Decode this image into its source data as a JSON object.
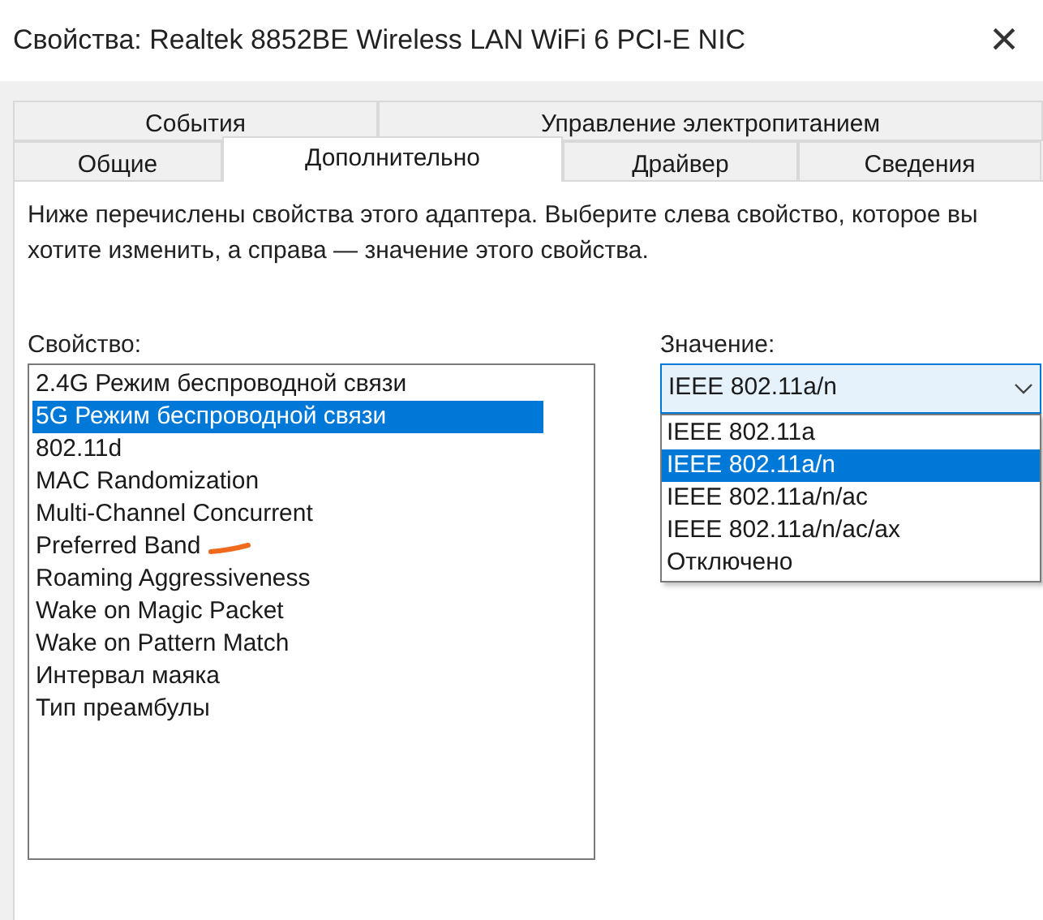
{
  "window": {
    "title": "Свойства: Realtek 8852BE Wireless LAN WiFi 6 PCI-E NIC",
    "close": "×"
  },
  "tab_rows": [
    [
      {
        "label": "События",
        "selected": false
      },
      {
        "label": "Управление электропитанием",
        "selected": false
      }
    ],
    [
      {
        "label": "Общие",
        "selected": false
      },
      {
        "label": "Дополнительно",
        "selected": true
      },
      {
        "label": "Драйвер",
        "selected": false
      },
      {
        "label": "Сведения",
        "selected": false
      }
    ]
  ],
  "description": "Ниже перечислены свойства этого адаптера. Выберите слева свойство, которое вы хотите изменить, а справа — значение этого свойства.",
  "property_label": "Свойство:",
  "properties": [
    {
      "label": "2.4G Режим беспроводной связи",
      "selected": false
    },
    {
      "label": "5G Режим беспроводной связи",
      "selected": true
    },
    {
      "label": "802.11d",
      "selected": false
    },
    {
      "label": "MAC Randomization",
      "selected": false
    },
    {
      "label": "Multi-Channel Concurrent",
      "selected": false
    },
    {
      "label": "Preferred Band",
      "selected": false
    },
    {
      "label": "Roaming Aggressiveness",
      "selected": false
    },
    {
      "label": "Wake on Magic Packet",
      "selected": false
    },
    {
      "label": "Wake on Pattern Match",
      "selected": false
    },
    {
      "label": "Интервал маяка",
      "selected": false
    },
    {
      "label": "Тип преамбулы",
      "selected": false
    }
  ],
  "value_label": "Значение:",
  "value_combo": {
    "value": "IEEE 802.11a/n",
    "expanded": true
  },
  "value_options": [
    {
      "label": "IEEE 802.11a",
      "selected": false
    },
    {
      "label": "IEEE 802.11a/n",
      "selected": true
    },
    {
      "label": "IEEE 802.11a/n/ac",
      "selected": false
    },
    {
      "label": "IEEE 802.11a/n/ac/ax",
      "selected": false
    },
    {
      "label": "Отключено",
      "selected": false
    }
  ]
}
